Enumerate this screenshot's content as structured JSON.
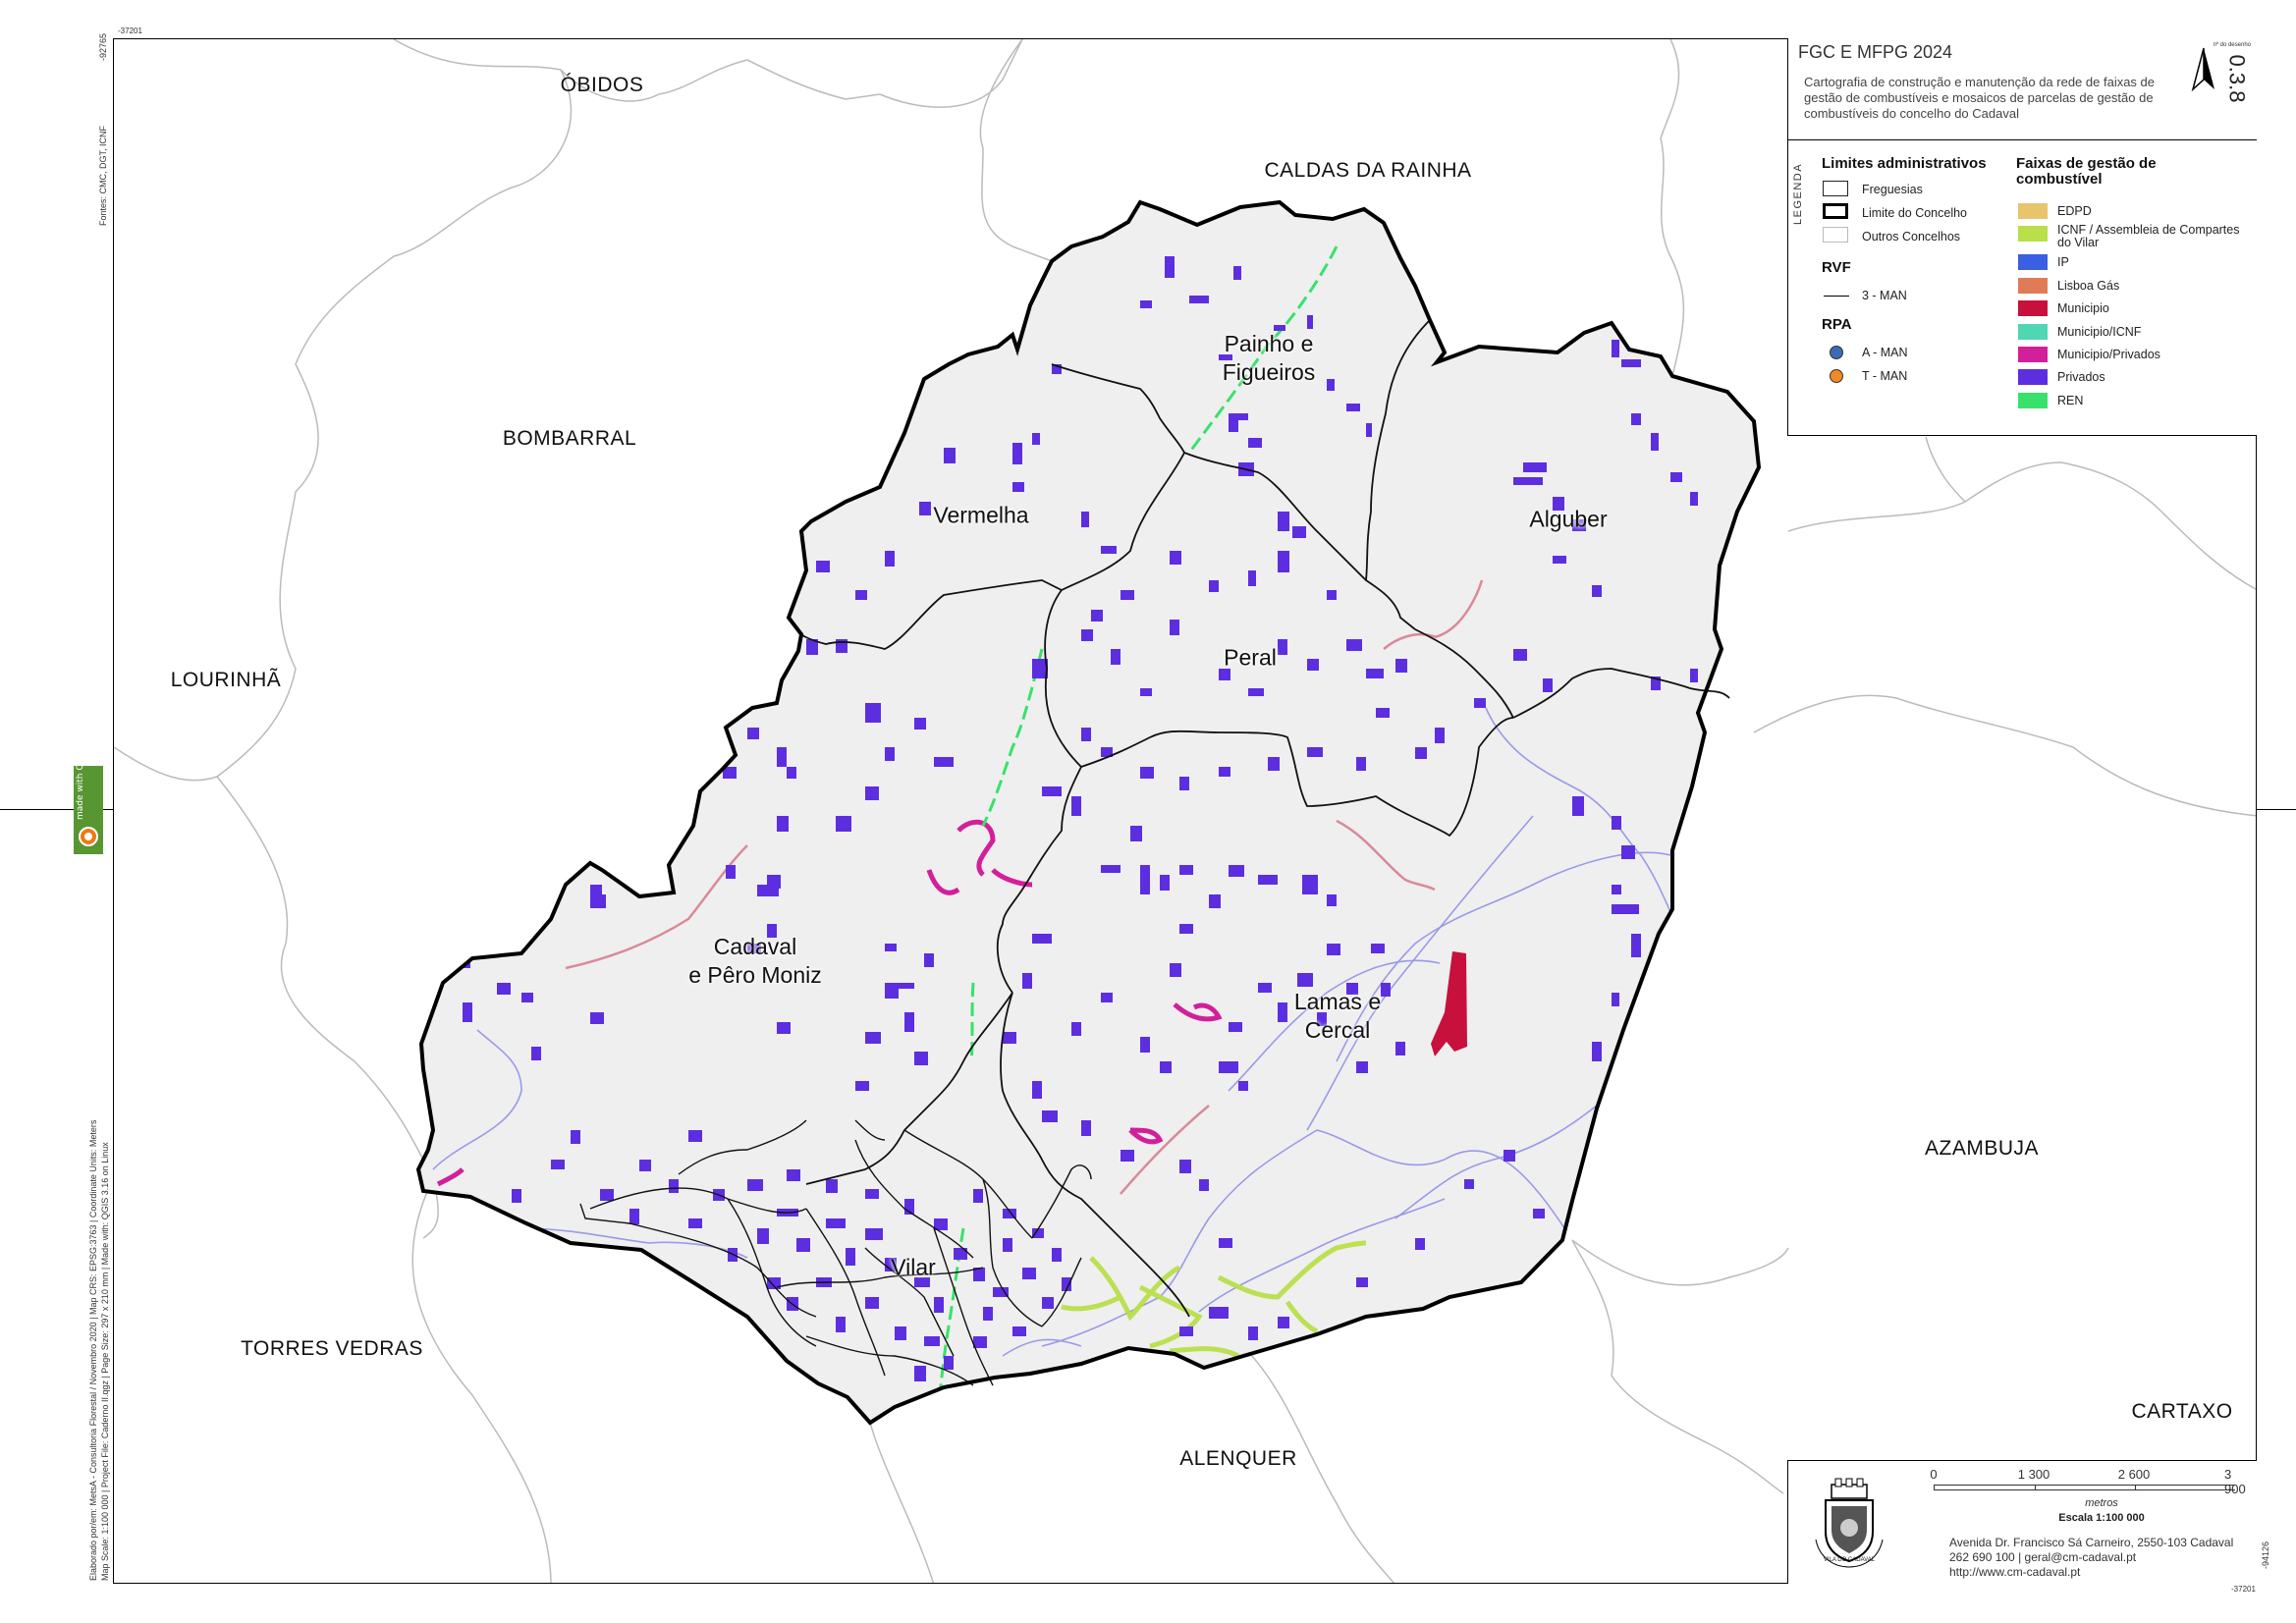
{
  "title": {
    "heading": "FGC E MFPG 2024",
    "description": "Cartografia de construção e manutenção da rede de faixas de gestão de combustíveis e mosaicos de parcelas de gestão de combustíveis do concelho do Cadaval",
    "drawing_number_label": "nº do desenho",
    "drawing_number": "0.3.8"
  },
  "neighbors": [
    "ÓBIDOS",
    "CALDAS DA RAINHA",
    "BOMBARRAL",
    "LOURINHÃ",
    "AZAMBUJA",
    "TORRES VEDRAS",
    "ALENQUER",
    "CARTAXO"
  ],
  "parishes": [
    "Painho e\nFigueiros",
    "Vermelha",
    "Alguber",
    "Peral",
    "Cadaval\ne Pêro Moniz",
    "Lamas e\nCercal",
    "Vilar"
  ],
  "legend": {
    "vertical_label": "LEGENDA",
    "admin_title": "Limites administrativos",
    "admin_items": [
      "Freguesias",
      "Limite do Concelho",
      "Outros Concelhos"
    ],
    "rvf_title": "RVF",
    "rvf_items": [
      "3 - MAN"
    ],
    "rpa_title": "RPA",
    "rpa_items": [
      {
        "label": "A - MAN",
        "color": "#3b6bb5"
      },
      {
        "label": "T - MAN",
        "color": "#f08a24"
      }
    ],
    "fgc_title": "Faixas de gestão de combustível",
    "fgc_items": [
      {
        "label": "EDPD",
        "color": "#e8c46a"
      },
      {
        "label": "ICNF / Assembleia de Compartes do Vilar",
        "color": "#b9df4a"
      },
      {
        "label": "IP",
        "color": "#3a5fe0"
      },
      {
        "label": "Lisboa Gás",
        "color": "#e07b58"
      },
      {
        "label": "Municipio",
        "color": "#c8103c"
      },
      {
        "label": "Municipio/ICNF",
        "color": "#4fd6b3"
      },
      {
        "label": "Municipio/Privados",
        "color": "#d21f9a"
      },
      {
        "label": "Privados",
        "color": "#5d2ee0"
      },
      {
        "label": "REN",
        "color": "#38e26a"
      }
    ]
  },
  "scalebar": {
    "ticks": [
      "0",
      "1 300",
      "2 600",
      "3 900"
    ],
    "unit": "metros",
    "scale": "Escala 1:100 000"
  },
  "address": [
    "Avenida Dr. Francisco Sá Carneiro, 2550-103 Cadaval",
    "262 690 100 | geral@cm-cadaval.pt",
    "http://www.cm-cadaval.pt"
  ],
  "margin": {
    "sources": "Fontes: CMC, DGT, ICNF",
    "credits_1": "Elaborado por/em: MetsA - Consultoria Florestal / Novembro 2020 | Map CRS: EPSG:3763 | Coordinate Units: Meters",
    "credits_2": "Map Scale: 1:100 000 | Project File: Caderno II.qgz | Page Size: 297 x 210 mm | Made with: QGIS 3.16 on Linux",
    "coord_top": "-37201",
    "coord_left_top": "-92765",
    "coord_bottom": "-37201",
    "coord_right_bottom": "-94126"
  },
  "qgis_badge": "made with QGIS",
  "crest_text": "VILA DO CADAVAL"
}
